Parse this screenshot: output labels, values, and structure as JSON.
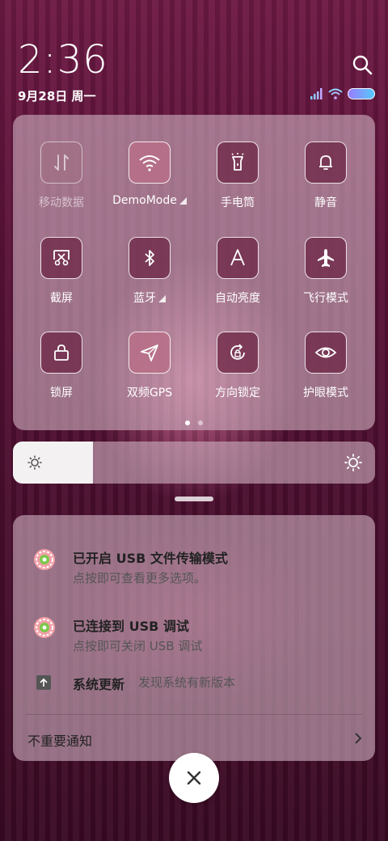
{
  "status": {
    "time": "2:36",
    "date": "9月28日 周一"
  },
  "quick_settings": {
    "tiles": [
      {
        "label": "移动数据",
        "icon": "mobile-data-icon",
        "state": "disabled"
      },
      {
        "label": "DemoMode",
        "icon": "wifi-icon",
        "state": "active"
      },
      {
        "label": "手电筒",
        "icon": "flashlight-icon",
        "state": "normal"
      },
      {
        "label": "静音",
        "icon": "bell-icon",
        "state": "normal"
      },
      {
        "label": "截屏",
        "icon": "screenshot-icon",
        "state": "normal"
      },
      {
        "label": "蓝牙",
        "icon": "bluetooth-icon",
        "state": "normal"
      },
      {
        "label": "自动亮度",
        "icon": "auto-brightness-icon",
        "state": "normal"
      },
      {
        "label": "飞行模式",
        "icon": "airplane-icon",
        "state": "normal"
      },
      {
        "label": "锁屏",
        "icon": "lock-icon",
        "state": "normal"
      },
      {
        "label": "双频GPS",
        "icon": "gps-icon",
        "state": "active"
      },
      {
        "label": "方向锁定",
        "icon": "rotation-lock-icon",
        "state": "normal"
      },
      {
        "label": "护眼模式",
        "icon": "eye-icon",
        "state": "normal"
      }
    ],
    "page_count": 2,
    "current_page": 1
  },
  "brightness": {
    "level": 0.22
  },
  "notifications": {
    "items": [
      {
        "title": "已开启 USB 文件传输模式",
        "subtitle": "点按即可查看更多选项。",
        "icon": "android-debug-icon"
      },
      {
        "title": "已连接到 USB 调试",
        "subtitle": "点按即可关闭 USB 调试",
        "icon": "android-debug-icon"
      }
    ],
    "update": {
      "title": "系统更新",
      "desc": "发现系统有新版本",
      "icon": "update-arrow-icon"
    },
    "unimportant_label": "不重要通知"
  },
  "colors": {
    "accent_tile_active": "#b96e87",
    "tile_normal": "#6e2846"
  }
}
